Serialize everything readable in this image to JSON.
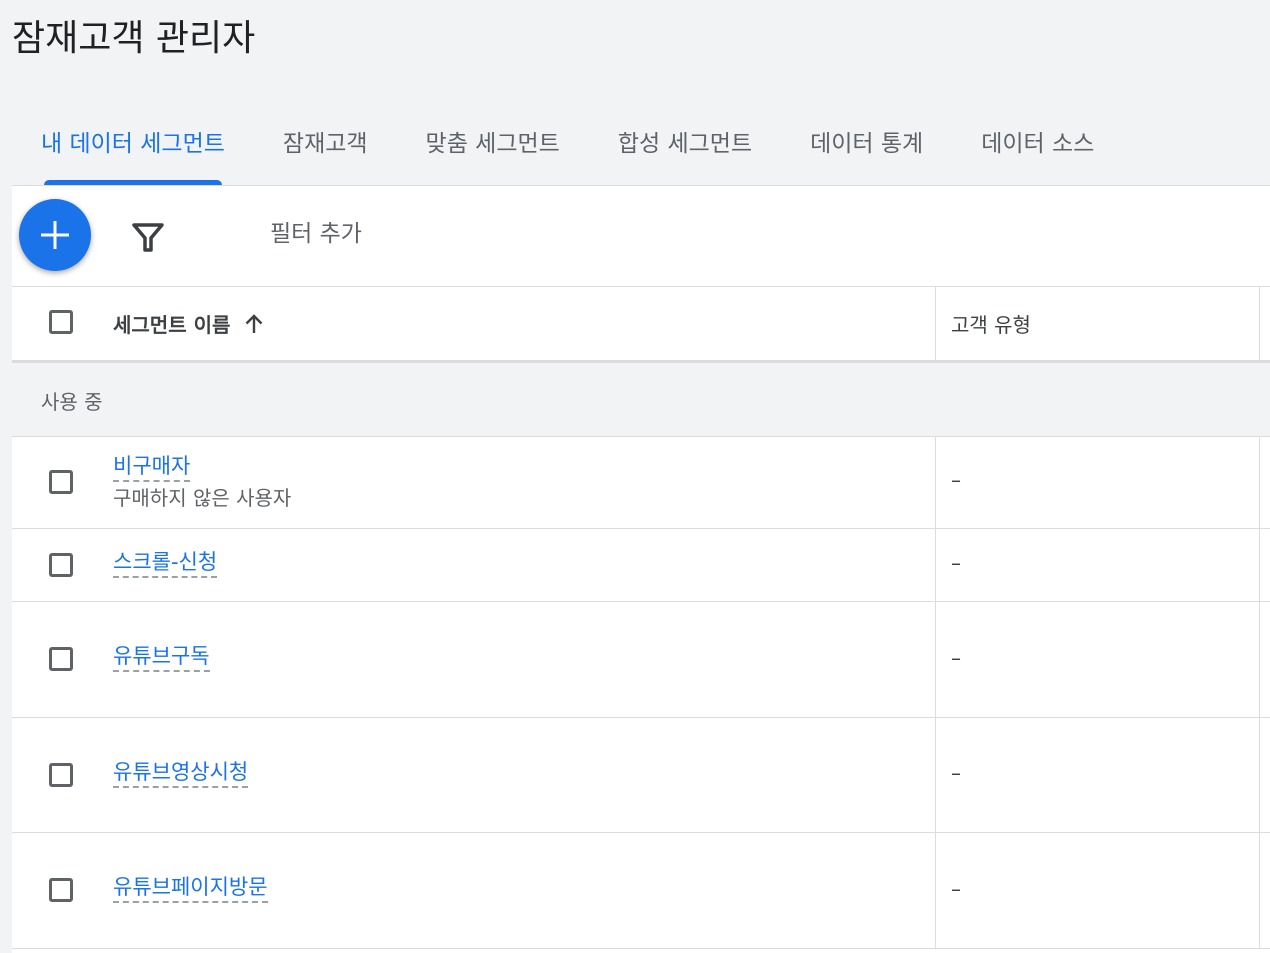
{
  "page": {
    "title": "잠재고객 관리자"
  },
  "tabs": [
    {
      "label": "내 데이터 세그먼트",
      "active": true
    },
    {
      "label": "잠재고객",
      "active": false
    },
    {
      "label": "맞춤 세그먼트",
      "active": false
    },
    {
      "label": "합성 세그먼트",
      "active": false
    },
    {
      "label": "데이터 통계",
      "active": false
    },
    {
      "label": "데이터 소스",
      "active": false
    }
  ],
  "toolbar": {
    "add_icon": "plus-icon",
    "filter_icon": "filter-icon",
    "add_filter_label": "필터 추가"
  },
  "table": {
    "columns": {
      "name": "세그먼트 이름",
      "type": "고객 유형"
    },
    "sort": "ascending",
    "group_label": "사용 중",
    "rows": [
      {
        "name": "비구매자",
        "description": "구매하지 않은 사용자",
        "type": "–"
      },
      {
        "name": "스크롤-신청",
        "description": "",
        "type": "–"
      },
      {
        "name": "유튜브구독",
        "description": "",
        "type": "–"
      },
      {
        "name": "유튜브영상시청",
        "description": "",
        "type": "–"
      },
      {
        "name": "유튜브페이지방문",
        "description": "",
        "type": "–"
      }
    ]
  },
  "colors": {
    "accent": "#1a73e8",
    "background": "#f1f3f4",
    "text": "#202124",
    "muted": "#5f6368"
  }
}
